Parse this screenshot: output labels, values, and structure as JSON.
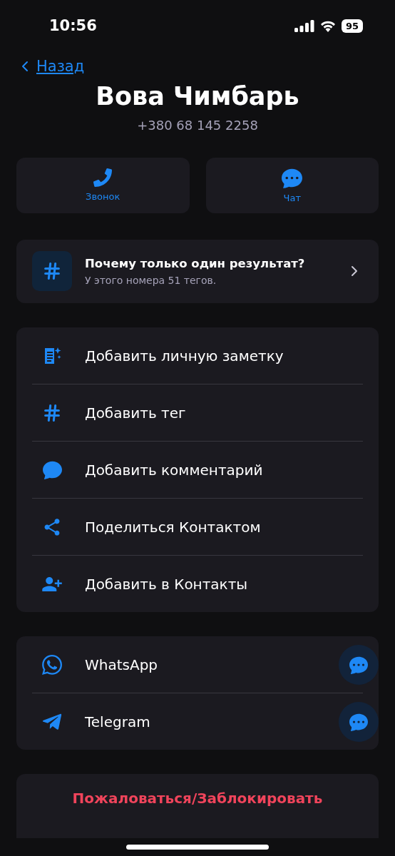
{
  "status_bar": {
    "time": "10:56",
    "battery": "95"
  },
  "nav": {
    "back": "Назад"
  },
  "contact": {
    "name": "Вова Чимбарь",
    "phone": "+380 68 145 2258"
  },
  "actions": [
    {
      "kind": "call",
      "label": "Звонок"
    },
    {
      "kind": "chat",
      "label": "Чат"
    }
  ],
  "info": {
    "title": "Почему только один результат?",
    "subtitle": "У этого номера 51 тегов."
  },
  "menu": [
    {
      "kind": "note",
      "label": "Добавить личную заметку"
    },
    {
      "kind": "tag",
      "label": "Добавить тег"
    },
    {
      "kind": "comment",
      "label": "Добавить комментарий"
    },
    {
      "kind": "share",
      "label": "Поделиться Контактом"
    },
    {
      "kind": "add-contact",
      "label": "Добавить в Контакты"
    }
  ],
  "messengers": [
    {
      "kind": "whatsapp",
      "label": "WhatsApp"
    },
    {
      "kind": "telegram",
      "label": "Telegram"
    }
  ],
  "report": {
    "label": "Пожаловаться/Заблокировать"
  }
}
